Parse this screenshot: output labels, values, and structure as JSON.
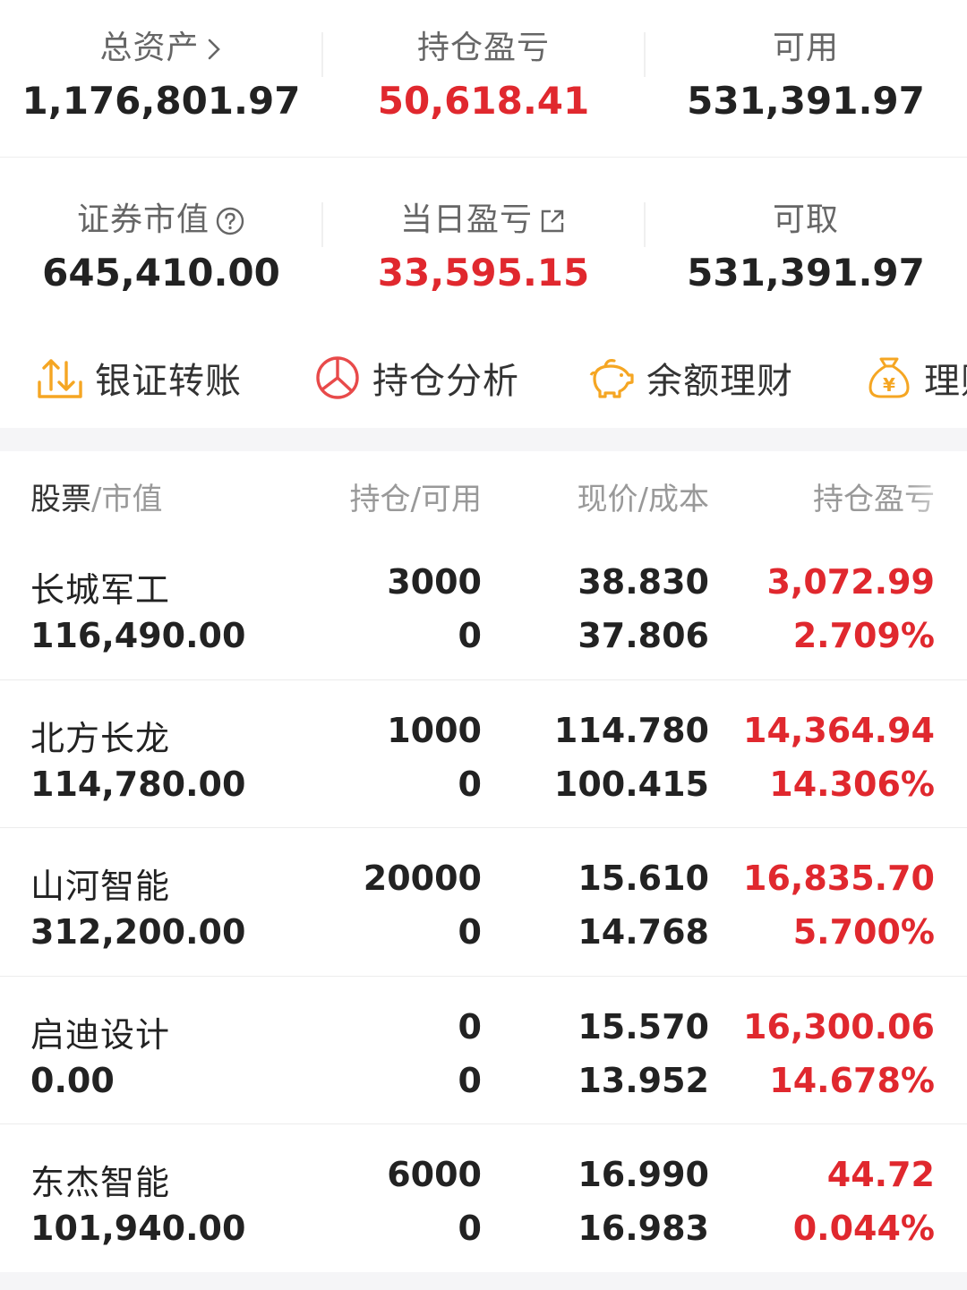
{
  "summary": {
    "total_assets": {
      "label": "总资产",
      "value": "1,176,801.97"
    },
    "position_pl": {
      "label": "持仓盈亏",
      "value": "50,618.41"
    },
    "available": {
      "label": "可用",
      "value": "531,391.97"
    },
    "market_value": {
      "label": "证券市值",
      "value": "645,410.00"
    },
    "daily_pl": {
      "label": "当日盈亏",
      "value": "33,595.15"
    },
    "withdrawable": {
      "label": "可取",
      "value": "531,391.97"
    }
  },
  "shortcuts": [
    {
      "label": "银证转账",
      "icon": "transfer-icon"
    },
    {
      "label": "持仓分析",
      "icon": "pie-chart-icon"
    },
    {
      "label": "余额理财",
      "icon": "piggy-bank-icon"
    },
    {
      "label": "理财",
      "icon": "money-bag-icon"
    }
  ],
  "table": {
    "headers": {
      "stock": "股票",
      "market_value": "/市值",
      "position": "持仓",
      "available": "/可用",
      "price": "现价",
      "cost": "/成本",
      "pl": "持仓盈亏"
    },
    "rows": [
      {
        "name": "长城军工",
        "market_value": "116,490.00",
        "qty": "3000",
        "avail": "0",
        "price": "38.830",
        "cost": "37.806",
        "pl": "3,072.99",
        "pct": "2.709%"
      },
      {
        "name": "北方长龙",
        "market_value": "114,780.00",
        "qty": "1000",
        "avail": "0",
        "price": "114.780",
        "cost": "100.415",
        "pl": "14,364.94",
        "pct": "14.306%"
      },
      {
        "name": "山河智能",
        "market_value": "312,200.00",
        "qty": "20000",
        "avail": "0",
        "price": "15.610",
        "cost": "14.768",
        "pl": "16,835.70",
        "pct": "5.700%"
      },
      {
        "name": "启迪设计",
        "market_value": "0.00",
        "qty": "0",
        "avail": "0",
        "price": "15.570",
        "cost": "13.952",
        "pl": "16,300.06",
        "pct": "14.678%"
      },
      {
        "name": "东杰智能",
        "market_value": "101,940.00",
        "qty": "6000",
        "avail": "0",
        "price": "16.990",
        "cost": "16.983",
        "pl": "44.72",
        "pct": "0.044%"
      }
    ]
  },
  "colors": {
    "gain_red": "#e0282e",
    "icon_orange": "#f5a623",
    "icon_red": "#e84a4a"
  }
}
